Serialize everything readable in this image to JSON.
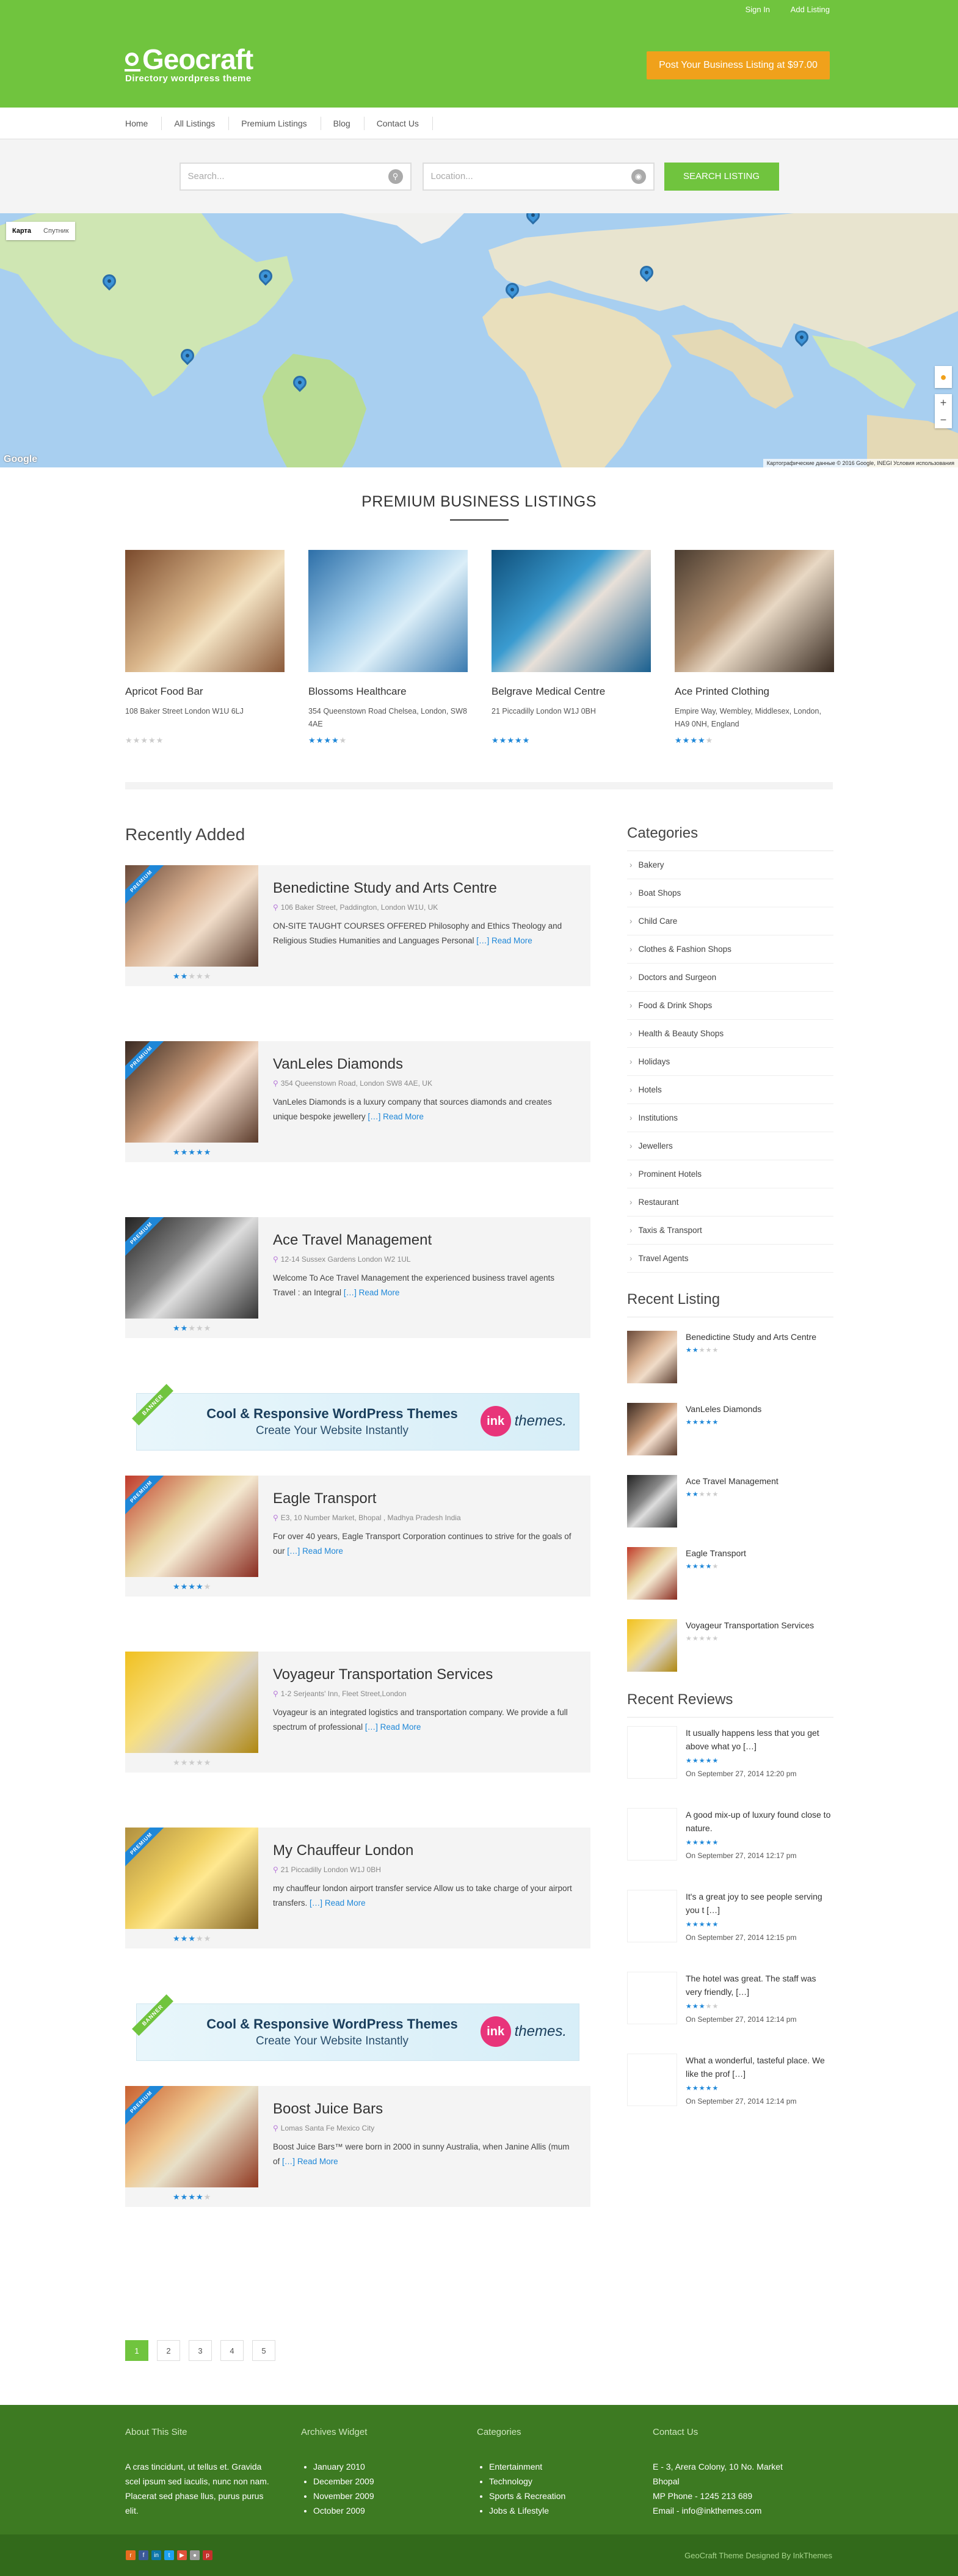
{
  "toplinks": {
    "signin": "Sign In",
    "add": "Add Listing"
  },
  "brand": {
    "name": "Geocraft",
    "tagline": "Directory wordpress theme"
  },
  "post_button": "Post Your Business Listing at $97.00",
  "nav": [
    "Home",
    "All Listings",
    "Premium Listings",
    "Blog",
    "Contact Us"
  ],
  "search": {
    "keyword_placeholder": "Search...",
    "location_placeholder": "Location...",
    "button": "SEARCH LISTING"
  },
  "map": {
    "type_map": "Карта",
    "type_sat": "Спутник",
    "google": "Google",
    "credits": "Картографические данные © 2016 Google, INEGI   Условия использования",
    "zoom_in": "+",
    "zoom_out": "−"
  },
  "premium": {
    "title": "PREMIUM BUSINESS LISTINGS",
    "items": [
      {
        "name": "Apricot Food Bar",
        "address": "108 Baker Street London W1U 6LJ",
        "rating": 0,
        "stars": "☆☆☆☆☆"
      },
      {
        "name": "Blossoms Healthcare",
        "address": "354 Queenstown Road Chelsea, London, SW8 4AE",
        "rating": 4,
        "stars": "★★★★☆"
      },
      {
        "name": "Belgrave Medical Centre",
        "address": "21 Piccadilly London W1J 0BH",
        "rating": 5,
        "stars": "★★★★★"
      },
      {
        "name": "Ace Printed Clothing",
        "address": "Empire Way, Wembley, Middlesex, London, HA9 0NH, England",
        "rating": 4,
        "stars": "★★★★☆"
      }
    ]
  },
  "recent": {
    "title": "Recently Added",
    "ribbon": "PREMIUM",
    "read_more": "Read More",
    "ellipsis": "[…]",
    "items": [
      {
        "title": "Benedictine Study and Arts Centre",
        "address": "106 Baker Street, Paddington, London W1U, UK",
        "desc": "ON-SITE TAUGHT COURSES OFFERED Philosophy and Ethics Theology and Religious Studies Humanities and Languages Personal",
        "premium": true,
        "rating": 2,
        "stars": "★★☆☆☆"
      },
      {
        "title": "VanLeles Diamonds",
        "address": "354 Queenstown Road, London SW8 4AE, UK",
        "desc": "VanLeles Diamonds is a luxury company that sources diamonds and creates unique bespoke jewellery",
        "premium": true,
        "rating": 5,
        "stars": "★★★★★"
      },
      {
        "title": "Ace Travel Management",
        "address": "12-14 Sussex Gardens London W2 1UL",
        "desc": "Welcome To Ace Travel Management the experienced business travel agents   Travel : an Integral",
        "premium": true,
        "rating": 2,
        "stars": "★★☆☆☆"
      },
      {
        "title": "Eagle Transport",
        "address": "E3, 10 Number Market, Bhopal , Madhya Pradesh India",
        "desc": "For over 40 years, Eagle Transport Corporation continues to strive for the goals of our",
        "premium": true,
        "rating": 4,
        "stars": "★★★★☆"
      },
      {
        "title": "Voyageur Transportation Services",
        "address": "1-2 Serjeants' Inn, Fleet Street,London",
        "desc": "Voyageur is an integrated logistics and transportation company. We provide a full spectrum of professional",
        "premium": false,
        "rating": 0,
        "stars": "☆☆☆☆☆"
      },
      {
        "title": "My Chauffeur London",
        "address": "21 Piccadilly London W1J 0BH",
        "desc": "my chauffeur london airport transfer service Allow us to take charge of your airport transfers.",
        "premium": true,
        "rating": 3,
        "stars": "★★★☆☆"
      },
      {
        "title": "Boost Juice Bars",
        "address": "Lomas Santa Fe Mexico City",
        "desc": "Boost Juice Bars™ were born in 2000 in sunny Australia, when Janine Allis (mum of",
        "premium": true,
        "rating": 4,
        "stars": "★★★★☆"
      }
    ]
  },
  "banner": {
    "ribbon": "BANNER",
    "line1": "Cool & Responsive WordPress Themes",
    "line2": "Create Your Website Instantly",
    "logo_icon": "ink",
    "logo_text": "themes."
  },
  "sidebar": {
    "categories_title": "Categories",
    "categories": [
      "Bakery",
      "Boat Shops",
      "Child Care",
      "Clothes & Fashion Shops",
      "Doctors and Surgeon",
      "Food & Drink Shops",
      "Health & Beauty Shops",
      "Holidays",
      "Hotels",
      "Institutions",
      "Jewellers",
      "Prominent Hotels",
      "Restaurant",
      "Taxis & Transport",
      "Travel Agents"
    ],
    "recent_title": "Recent Listing",
    "recent": [
      {
        "title": "Benedictine Study and Arts Centre",
        "rating": 2,
        "stars": "★★☆☆☆"
      },
      {
        "title": "VanLeles Diamonds",
        "rating": 5,
        "stars": "★★★★★"
      },
      {
        "title": "Ace Travel Management",
        "rating": 2,
        "stars": "★★☆☆☆"
      },
      {
        "title": "Eagle Transport",
        "rating": 4,
        "stars": "★★★★☆"
      },
      {
        "title": "Voyageur Transportation Services",
        "rating": 0,
        "stars": "☆☆☆☆☆"
      }
    ],
    "reviews_title": "Recent Reviews",
    "reviews": [
      {
        "text": "It usually happens less that you get above what yo […]",
        "rating": 5,
        "stars": "★★★★★",
        "date": "On September 27, 2014 12:20 pm"
      },
      {
        "text": "A good mix-up of luxury found close to nature.",
        "rating": 5,
        "stars": "★★★★★",
        "date": "On September 27, 2014 12:17 pm"
      },
      {
        "text": "It's a great joy to see people serving you t […]",
        "rating": 5,
        "stars": "★★★★★",
        "date": "On September 27, 2014 12:15 pm"
      },
      {
        "text": "The hotel was great. The staff was very friendly, […]",
        "rating": 3,
        "stars": "★★★☆☆",
        "date": "On September 27, 2014 12:14 pm"
      },
      {
        "text": "What a wonderful, tasteful place. We like the prof […]",
        "rating": 5,
        "stars": "★★★★★",
        "date": "On September 27, 2014 12:14 pm"
      }
    ]
  },
  "pagination": [
    "1",
    "2",
    "3",
    "4",
    "5"
  ],
  "footer": {
    "about_title": "About This Site",
    "about_text": "A cras tincidunt, ut tellus et. Gravida scel ipsum sed iaculis, nunc non nam. Placerat sed phase llus, purus purus elit.",
    "archives_title": "Archives Widget",
    "archives": [
      "January 2010",
      "December 2009",
      "November 2009",
      "October 2009"
    ],
    "categories_title": "Categories",
    "categories": [
      "Entertainment",
      "Technology",
      "Sports & Recreation",
      "Jobs & Lifestyle"
    ],
    "contact_title": "Contact Us",
    "contact": [
      "E - 3, Arera Colony, 10 No. Market",
      "Bhopal",
      "MP Phone - 1245 213 689",
      "Email - info@inkthemes.com"
    ],
    "credit": "GeoCraft Theme Designed By InkThemes"
  },
  "colors": {
    "brand_green": "#70c43e",
    "button_orange": "#f0a11b",
    "star_blue": "#1e87d8",
    "footer_green": "#3d7a22"
  }
}
